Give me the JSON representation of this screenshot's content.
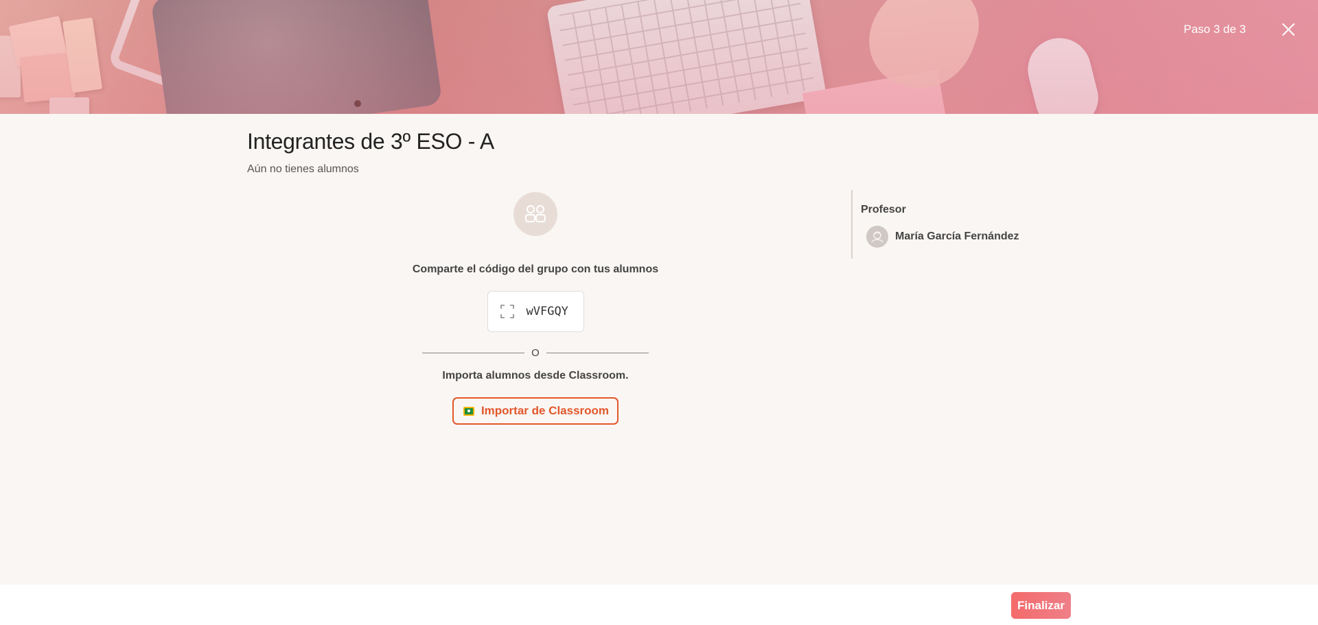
{
  "header": {
    "step_label": "Paso 3 de 3",
    "close_icon": "close-icon"
  },
  "main": {
    "title": "Integrantes de 3º ESO - A",
    "subtitle": "Aún no tienes alumnos",
    "group_icon": "group-icon",
    "share_text": "Comparte el código del grupo con tus alumnos",
    "code": {
      "value": "wVFGQY",
      "icon": "expand-icon"
    },
    "divider_text": "O",
    "import_text": "Importa alumnos desde Classroom.",
    "import_button": {
      "label": "Importar de Classroom",
      "icon": "classroom-icon"
    }
  },
  "teacher": {
    "heading": "Profesor",
    "name": "María García Fernández",
    "avatar_icon": "teacher-avatar-icon"
  },
  "footer": {
    "finish_label": "Finalizar"
  },
  "colors": {
    "accent": "#e3572b",
    "finish_button": "#f46b6b",
    "background": "#f9f6f3",
    "banner_tint": "#e596a3"
  }
}
